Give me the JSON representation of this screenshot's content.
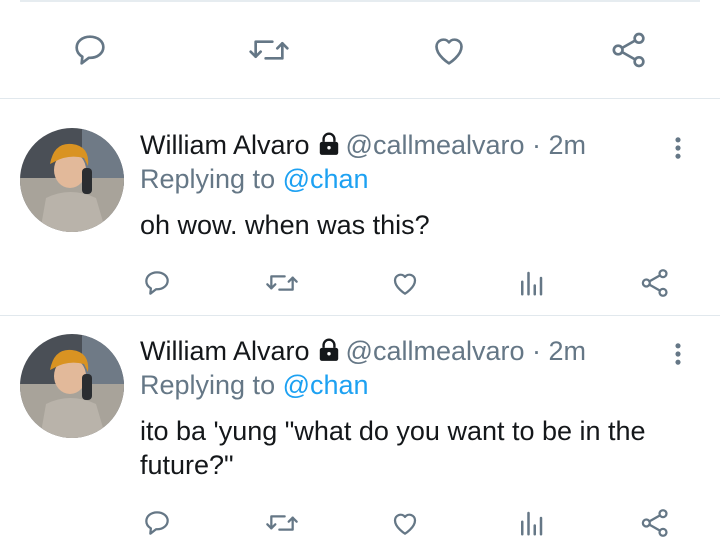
{
  "icons": {
    "reply": "reply-icon",
    "retweet": "retweet-icon",
    "like": "heart-icon",
    "analytics": "analytics-icon",
    "share": "share-icon",
    "more": "more-vertical-icon",
    "lock": "lock-icon"
  },
  "colors": {
    "icon": "#657786",
    "mention": "#1da1f2",
    "divider": "#e1e8ed"
  },
  "tweets": [
    {
      "name": "William Alvaro",
      "handle": "@callmealvaro",
      "separator": "·",
      "time": "2m",
      "replying_prefix": "Replying to",
      "replying_to": "@chan",
      "text": "oh wow. when was this?"
    },
    {
      "name": "William Alvaro",
      "handle": "@callmealvaro",
      "separator": "·",
      "time": "2m",
      "replying_prefix": "Replying to",
      "replying_to": "@chan",
      "text": "ito ba 'yung \"what do you want to be in the future?\""
    }
  ]
}
